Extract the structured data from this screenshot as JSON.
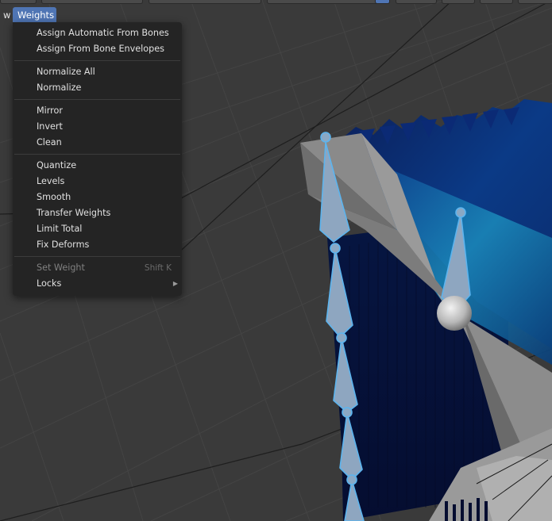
{
  "menubar": {
    "view_partial_label": "w",
    "weights_label": "Weights"
  },
  "weights_menu": {
    "assign_automatic_from_bones": "Assign Automatic From Bones",
    "assign_from_bone_envelopes": "Assign From Bone Envelopes",
    "normalize_all": "Normalize All",
    "normalize": "Normalize",
    "mirror": "Mirror",
    "invert": "Invert",
    "clean": "Clean",
    "quantize": "Quantize",
    "levels": "Levels",
    "smooth": "Smooth",
    "transfer_weights": "Transfer Weights",
    "limit_total": "Limit Total",
    "fix_deforms": "Fix Deforms",
    "set_weight": "Set Weight",
    "set_weight_shortcut": "Shift K",
    "locks": "Locks"
  },
  "colors": {
    "viewport_bg": "#3a3a3a",
    "menu_bg": "#242424",
    "menu_highlight": "#4f75b4",
    "bone_outline": "#5cb4ee",
    "mesh_blue": "#0a2a6a"
  }
}
